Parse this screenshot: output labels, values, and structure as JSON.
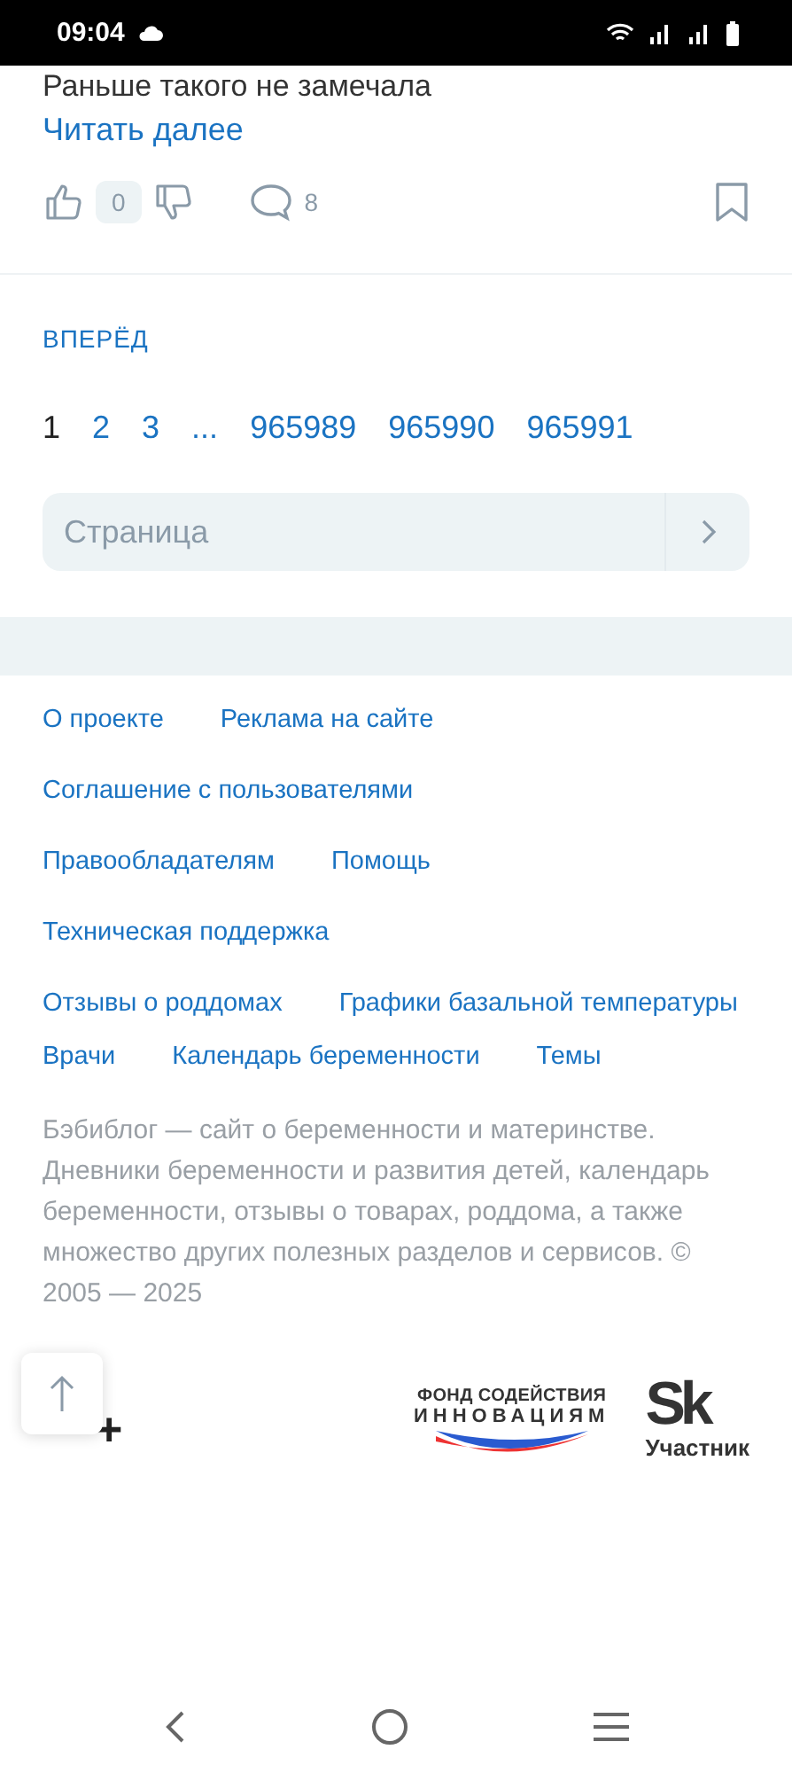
{
  "status_bar": {
    "time": "09:04"
  },
  "post": {
    "last_line": "Раньше такого не замечала",
    "read_more": "Читать далее",
    "likes": "0",
    "comments": "8"
  },
  "pagination": {
    "next": "ВПЕРЁД",
    "pages": [
      {
        "label": "1",
        "selected": true
      },
      {
        "label": "2",
        "selected": false
      },
      {
        "label": "3",
        "selected": false
      },
      {
        "label": "...",
        "selected": false
      },
      {
        "label": "965989",
        "selected": false
      },
      {
        "label": "965990",
        "selected": false
      },
      {
        "label": "965991",
        "selected": false
      }
    ],
    "page_field": {
      "placeholder": "Страница"
    }
  },
  "footer": {
    "link_rows": [
      [
        "О проекте",
        "Реклама на сайте"
      ],
      [
        "Соглашение с пользователями"
      ],
      [
        "Правообладателям",
        "Помощь"
      ],
      [
        "Техническая поддержка"
      ],
      [
        "Отзывы о роддомах",
        "Графики базальной температуры",
        "Врачи",
        "Календарь беременности",
        "Темы"
      ]
    ],
    "about": "Бэбиблог — сайт о беременности и материнстве. Дневники беременности и развития детей, календарь беременности, отзывы о товарах, роддома, а также множество других полезных разделов и сервисов. © 2005 — 2025",
    "age": "+",
    "fund_logo": [
      "ФОНД СОДЕЙСТВИЯ",
      "ИННОВАЦИЯМ"
    ],
    "sk_logo": {
      "mark": "Sk",
      "caption": "Участник"
    }
  }
}
